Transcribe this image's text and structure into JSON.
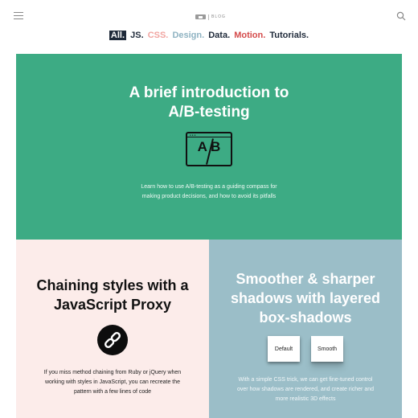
{
  "header": {
    "logo_text": "BLOG",
    "menu_icon": "hamburger-menu-icon",
    "search_icon": "search-icon"
  },
  "categories": [
    {
      "label": "All.",
      "color": "#1f2a3a",
      "active": true
    },
    {
      "label": "JS.",
      "color": "#1f2a3a"
    },
    {
      "label": "CSS.",
      "color": "#f1a4a0"
    },
    {
      "label": "Design.",
      "color": "#8fb3c2"
    },
    {
      "label": "Data.",
      "color": "#1f2a3a"
    },
    {
      "label": "Motion.",
      "color": "#d44a4a"
    },
    {
      "label": "Tutorials.",
      "color": "#1f2a3a"
    }
  ],
  "posts": {
    "ab_testing": {
      "title": "A brief introduction to A/B-testing",
      "description": "Learn how to use A/B-testing as a guiding compass for making product decisions, and how to avoid its pitfalls",
      "icon_text": "A B",
      "icon": "ab-window-icon",
      "bg_color": "#3dab84"
    },
    "js_proxy": {
      "title": "Chaining styles with a JavaScript Proxy",
      "description": "If you miss method chaining from Ruby or jQuery when working with styles in JavaScript, you can recreate the pattern with a few lines of code",
      "icon": "chain-link-icon",
      "bg_color": "#fcecea"
    },
    "box_shadows": {
      "title": "Smoother & sharper shadows with layered box-shadows",
      "description": "With a simple CSS trick, we can get fine-tuned control over how shadows are rendered, and create richer and more realistic 3D effects",
      "default_label": "Default",
      "smooth_label": "Smooth",
      "bg_color": "#9bbec8"
    }
  }
}
